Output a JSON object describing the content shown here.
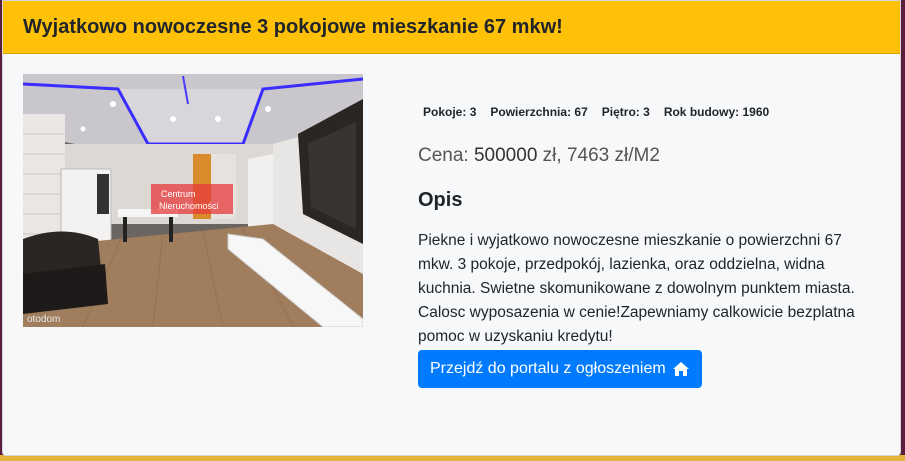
{
  "listing": {
    "title": "Wyjatkowo nowoczesne 3 pokojowe mieszkanie 67 mkw!",
    "specs": [
      {
        "label": "Pokoje:",
        "value": "3"
      },
      {
        "label": "Powierzchnia:",
        "value": "67"
      },
      {
        "label": "Piętro:",
        "value": "3"
      },
      {
        "label": "Rok budowy:",
        "value": "1960"
      }
    ],
    "price": {
      "prefix": "Cena:",
      "amount": "500000",
      "suffix": "zł, 7463 zł/M2"
    },
    "description_title": "Opis",
    "description": "Piekne i wyjatkowo nowoczesne mieszkanie o powierzchni 67 mkw. 3 pokoje, przedpokój, lazienka, oraz oddzielna, widna kuchnia. Swietne skomunikowane z dowolnym punktem miasta. Calosc wyposazenia w cenie!Zapewniamy calkowicie bezplatna pomoc w uzyskaniu kredytu!",
    "portal_button_label": "Przejdź do portalu z ogłoszeniem",
    "portal_button_icon": "home-icon",
    "photo": {
      "watermark_line1": "Centrum",
      "watermark_line2": "Nieruchomości",
      "source_mark": "otodom"
    }
  },
  "colors": {
    "header_bg": "#ffc107",
    "button_bg": "#007bff",
    "page_bg": "#5a1f3c"
  }
}
